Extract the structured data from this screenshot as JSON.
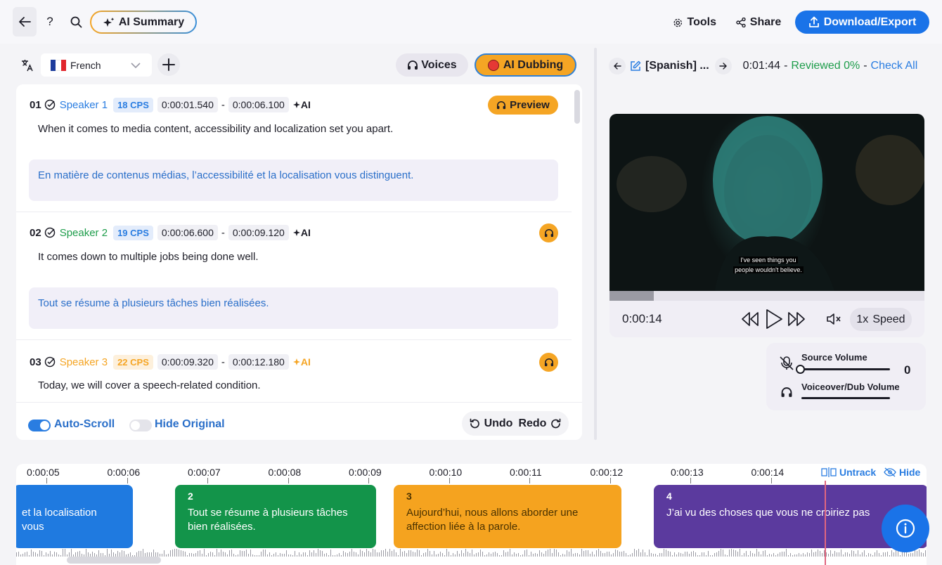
{
  "topbar": {
    "ai_summary_label": "AI Summary",
    "tools_label": "Tools",
    "share_label": "Share",
    "download_label": "Download/Export",
    "help_label": "?"
  },
  "editor": {
    "language": "French",
    "voices_label": "Voices",
    "dubbing_label": "AI Dubbing",
    "segments": [
      {
        "num": "01",
        "speaker": "Speaker 1",
        "speaker_color": "#2a7de1",
        "cps": "18 CPS",
        "cps_color": "#2a7de1",
        "cps_bg": "#e3ecfb",
        "start": "0:00:01.540",
        "end": "0:00:06.100",
        "ai_label": "AI",
        "ai_color": "#1d1d27",
        "original": "When it comes to media content, accessibility and localization set you apart.",
        "translation": "En matière de contenus médias, l’accessibilité et la localisation vous distinguent.",
        "preview_label": "Preview"
      },
      {
        "num": "02",
        "speaker": "Speaker 2",
        "speaker_color": "#1e9d4b",
        "cps": "19 CPS",
        "cps_color": "#2a7de1",
        "cps_bg": "#e3ecfb",
        "start": "0:00:06.600",
        "end": "0:00:09.120",
        "ai_label": "AI",
        "ai_color": "#1d1d27",
        "original": "It comes down to multiple jobs being done well.",
        "translation": "Tout se résume à plusieurs tâches bien réalisées."
      },
      {
        "num": "03",
        "speaker": "Speaker 3",
        "speaker_color": "#f5a524",
        "cps": "22 CPS",
        "cps_color": "#f5a524",
        "cps_bg": "#fdf0dc",
        "start": "0:00:09.320",
        "end": "0:00:12.180",
        "ai_label": "AI",
        "ai_color": "#f5a524",
        "original": "Today, we will cover a speech-related condition."
      }
    ],
    "auto_scroll_label": "Auto-Scroll",
    "auto_scroll_on": true,
    "hide_original_label": "Hide Original",
    "hide_original_on": false,
    "undo_label": "Undo",
    "redo_label": "Redo"
  },
  "preview": {
    "track": "[Spanish] ...",
    "duration": "0:01:44",
    "reviewed": "Reviewed 0%",
    "check_all": "Check All",
    "sep": "-",
    "subtitle_line1": "I've seen things you",
    "subtitle_line2": "people wouldn't believe.",
    "current_time": "0:00:14",
    "progress": 0.14,
    "speed_label": "1x",
    "speed_word": "Speed",
    "source_volume_label": "Source Volume",
    "source_volume_value": "0",
    "dub_volume_label": "Voiceover/Dub Volume"
  },
  "timeline": {
    "ticks": [
      "0:00:05",
      "0:00:06",
      "0:00:07",
      "0:00:08",
      "0:00:09",
      "0:00:10",
      "0:00:11",
      "0:00:12",
      "0:00:13",
      "0:00:14"
    ],
    "untrack_label": "Untrack",
    "hide_label": "Hide",
    "clips": [
      {
        "num": "",
        "text": "et la localisation vous",
        "color": "#1f7ae0"
      },
      {
        "num": "2",
        "text": "Tout se résume à plusieurs tâches bien réalisées.",
        "color": "#13944a"
      },
      {
        "num": "3",
        "text": "Aujourd’hui, nous allons aborder une affection liée à la parole.",
        "color": "#f5a31f"
      },
      {
        "num": "4",
        "text": "J’ai vu des choses que vous ne croiriez pas",
        "color": "#5b3a9e"
      }
    ]
  }
}
